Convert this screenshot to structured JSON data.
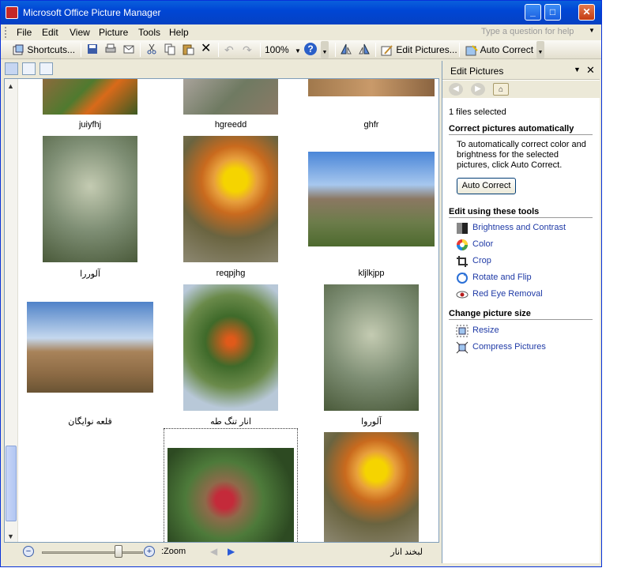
{
  "window": {
    "title": "Microsoft Office Picture Manager"
  },
  "menu": {
    "file": "File",
    "edit": "Edit",
    "view": "View",
    "picture": "Picture",
    "tools": "Tools",
    "help": "Help"
  },
  "help_placeholder": "Type a question for help",
  "toolbar": {
    "shortcuts": "Shortcuts...",
    "zoom": "100%",
    "edit_pictures": "Edit Pictures...",
    "auto_correct": "Auto Correct"
  },
  "thumbnails": [
    {
      "caption": "juiyfhj"
    },
    {
      "caption": "hgreedd"
    },
    {
      "caption": "ghfr"
    },
    {
      "caption": "آلوررا"
    },
    {
      "caption": "reqpjhg"
    },
    {
      "caption": "kljlkjpp"
    },
    {
      "caption": "قلعه نوایگان"
    },
    {
      "caption": "انار تنگ طه"
    },
    {
      "caption": "آلوروا"
    },
    {
      "caption": ""
    },
    {
      "caption": "لبخند انار"
    }
  ],
  "zoombar": {
    "label": ":Zoom"
  },
  "pane": {
    "title": "Edit Pictures",
    "files_selected": "1 files selected",
    "correct_heading": "Correct pictures automatically",
    "correct_text": "To automatically correct color and brightness for the selected pictures, click Auto Correct.",
    "auto_correct_button": "Auto Correct",
    "tools_heading": "Edit using these tools",
    "tools": [
      "Brightness and Contrast",
      "Color",
      "Crop",
      "Rotate and Flip",
      "Red Eye Removal"
    ],
    "size_heading": "Change picture size",
    "size_tools": [
      "Resize",
      "Compress Pictures"
    ]
  },
  "colors": {
    "titlebar": "#0054e3",
    "link": "#1f3aa6",
    "chrome": "#ece9d8"
  }
}
